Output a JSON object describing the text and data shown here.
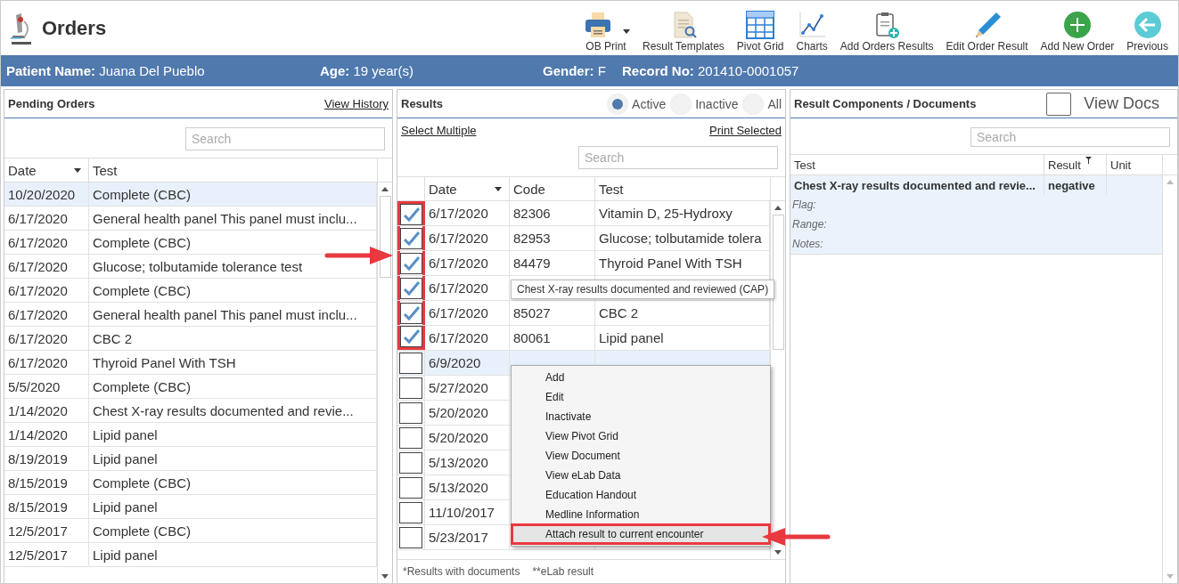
{
  "app": {
    "title": "Orders"
  },
  "toolbar": [
    {
      "label": "OB Print",
      "kind": "print",
      "dropdown": true
    },
    {
      "label": "Result Templates",
      "kind": "template",
      "dropdown": false
    },
    {
      "label": "Pivot Grid",
      "kind": "grid",
      "dropdown": false
    },
    {
      "label": "Charts",
      "kind": "chart",
      "dropdown": false
    },
    {
      "label": "Add Orders Results",
      "kind": "clipboard",
      "dropdown": false
    },
    {
      "label": "Edit Order Result",
      "kind": "pencil",
      "dropdown": false
    },
    {
      "label": "Add New Order",
      "kind": "plus",
      "dropdown": false
    },
    {
      "label": "Previous",
      "kind": "back",
      "dropdown": false
    }
  ],
  "patient_bar": [
    {
      "label": "Patient Name:",
      "value": "Juana Del Pueblo"
    },
    {
      "label": "Age:",
      "value": "19 year(s)"
    },
    {
      "label": "Gender:",
      "value": "F"
    },
    {
      "label": "Record No:",
      "value": "201410-0001057"
    }
  ],
  "pending_orders": {
    "title": "Pending Orders",
    "link": "View History",
    "search": {
      "placeholder": "Search"
    },
    "columns": [
      "Date",
      "Test"
    ],
    "rows": [
      {
        "date": "10/20/2020",
        "test": "Complete (CBC)",
        "selected": true
      },
      {
        "date": "6/17/2020",
        "test": "General health panel This panel must inclu...",
        "selected": false
      },
      {
        "date": "6/17/2020",
        "test": "Complete (CBC)",
        "selected": false
      },
      {
        "date": "6/17/2020",
        "test": "Glucose; tolbutamide tolerance test",
        "selected": false
      },
      {
        "date": "6/17/2020",
        "test": "Complete (CBC)",
        "selected": false
      },
      {
        "date": "6/17/2020",
        "test": "General health panel This panel must inclu...",
        "selected": false
      },
      {
        "date": "6/17/2020",
        "test": "CBC 2",
        "selected": false
      },
      {
        "date": "6/17/2020",
        "test": "Thyroid Panel With TSH",
        "selected": false
      },
      {
        "date": "5/5/2020",
        "test": "Complete (CBC)",
        "selected": false
      },
      {
        "date": "1/14/2020",
        "test": "Chest X-ray results documented and revie...",
        "selected": false
      },
      {
        "date": "1/14/2020",
        "test": "Lipid panel",
        "selected": false
      },
      {
        "date": "8/19/2019",
        "test": "Lipid panel",
        "selected": false
      },
      {
        "date": "8/15/2019",
        "test": "Complete (CBC)",
        "selected": false
      },
      {
        "date": "8/15/2019",
        "test": "Lipid panel",
        "selected": false
      },
      {
        "date": "12/5/2017",
        "test": "Complete (CBC)",
        "selected": false
      },
      {
        "date": "12/5/2017",
        "test": "Lipid panel",
        "selected": false
      }
    ]
  },
  "results": {
    "title": "Results",
    "filters": [
      {
        "label": "Active",
        "selected": true
      },
      {
        "label": "Inactive",
        "selected": false
      },
      {
        "label": "All",
        "selected": false
      }
    ],
    "links": [
      "Select Multiple",
      "Print Selected"
    ],
    "search": {
      "placeholder": "Search"
    },
    "columns": [
      "Date",
      "Code",
      "Test"
    ],
    "rows": [
      {
        "checked": true,
        "date": "6/17/2020",
        "code": "82306",
        "test": "Vitamin D, 25-Hydroxy",
        "selected": false
      },
      {
        "checked": true,
        "date": "6/17/2020",
        "code": "82953",
        "test": "Glucose; tolbutamide tolera",
        "selected": false
      },
      {
        "checked": true,
        "date": "6/17/2020",
        "code": "84479",
        "test": "Thyroid Panel With TSH",
        "selected": false
      },
      {
        "checked": true,
        "date": "6/17/2020",
        "selected": false
      },
      {
        "checked": true,
        "date": "6/17/2020",
        "code": "85027",
        "test": "CBC 2",
        "selected": false
      },
      {
        "checked": true,
        "date": "6/17/2020",
        "code": "80061",
        "test": "Lipid panel",
        "selected": false
      },
      {
        "checked": false,
        "date": "6/9/2020",
        "selected": true
      },
      {
        "checked": false,
        "date": "5/27/2020",
        "selected": false
      },
      {
        "checked": false,
        "date": "5/20/2020",
        "selected": false
      },
      {
        "checked": false,
        "date": "5/20/2020",
        "selected": false
      },
      {
        "checked": false,
        "date": "5/13/2020",
        "selected": false
      },
      {
        "checked": false,
        "date": "5/13/2020",
        "selected": false
      },
      {
        "checked": false,
        "date": "11/10/2017",
        "selected": false
      },
      {
        "checked": false,
        "date": "5/23/2017",
        "selected": false
      }
    ],
    "footer": [
      "*Results with documents",
      "**eLab result"
    ],
    "tooltip": "Chest X-ray results documented and reviewed (CAP)",
    "context_menu": [
      {
        "label": "Add",
        "selected": false
      },
      {
        "label": "Edit",
        "selected": false
      },
      {
        "label": "Inactivate",
        "selected": false
      },
      {
        "label": "View Pivot Grid",
        "selected": false
      },
      {
        "label": "View Document",
        "selected": false
      },
      {
        "label": "View eLab Data",
        "selected": false
      },
      {
        "label": "Education Handout",
        "selected": false
      },
      {
        "label": "Medline Information",
        "selected": false
      },
      {
        "label": "Attach result to current encounter",
        "selected": true
      }
    ]
  },
  "components": {
    "title": "Result Components / Documents",
    "view_docs": {
      "label": "View Docs",
      "checked": false
    },
    "search": {
      "placeholder": "Search"
    },
    "columns": [
      "Test",
      "Result",
      "Unit"
    ],
    "rows": [
      {
        "test": "Chest X-ray results documented and revie...",
        "result": "negative",
        "details": [
          "Flag:",
          "Range:",
          "Notes:"
        ]
      }
    ]
  }
}
